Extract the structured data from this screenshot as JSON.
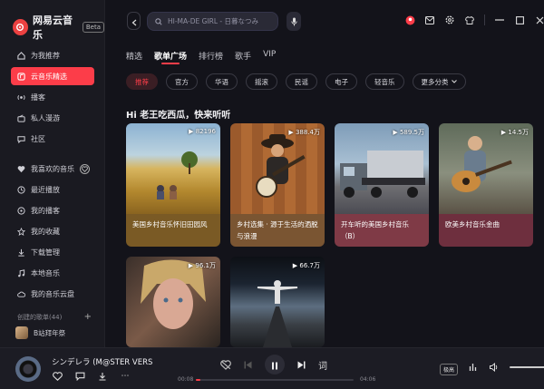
{
  "app": {
    "name": "网易云音乐",
    "beta": "Beta"
  },
  "sidebar": {
    "items": [
      {
        "label": "为我推荐",
        "icon": "home-icon"
      },
      {
        "label": "云音乐精选",
        "icon": "music-note-icon",
        "active": true
      },
      {
        "label": "播客",
        "icon": "podcast-icon"
      },
      {
        "label": "私人漫游",
        "icon": "radio-icon"
      },
      {
        "label": "社区",
        "icon": "community-icon"
      }
    ],
    "my_items": [
      {
        "label": "我喜欢的音乐",
        "icon": "heart-icon"
      },
      {
        "label": "最近播放",
        "icon": "clock-icon"
      },
      {
        "label": "我的播客",
        "icon": "podcast-icon"
      },
      {
        "label": "我的收藏",
        "icon": "star-icon"
      },
      {
        "label": "下载管理",
        "icon": "download-icon"
      },
      {
        "label": "本地音乐",
        "icon": "music-icon"
      },
      {
        "label": "我的音乐云盘",
        "icon": "cloud-icon"
      }
    ],
    "created_playlists": "创建的歌单(44)",
    "playlist_item": "B站拜年祭"
  },
  "search": {
    "placeholder": "HI-MA-DE GIRL - 日暮なつみ"
  },
  "tabs": [
    {
      "label": "精选"
    },
    {
      "label": "歌单广场",
      "active": true
    },
    {
      "label": "排行榜"
    },
    {
      "label": "歌手"
    },
    {
      "label": "VIP"
    }
  ],
  "chips": [
    {
      "label": "推荐",
      "active": true
    },
    {
      "label": "官方"
    },
    {
      "label": "华语"
    },
    {
      "label": "摇滚"
    },
    {
      "label": "民谣"
    },
    {
      "label": "电子"
    },
    {
      "label": "轻音乐"
    },
    {
      "label": "更多分类"
    }
  ],
  "greeting": "Hi 老王吃西瓜，快来听听",
  "cards": [
    {
      "count": "82196",
      "title": "美国乡村音乐怀旧田园风",
      "caption_color": "#7a5a25"
    },
    {
      "count": "388.4万",
      "title": "乡村选集 · 源于生活的洒脱与浪漫",
      "caption_color": "#7a5532"
    },
    {
      "count": "589.5万",
      "title": "开车听的美国乡村音乐（B）",
      "caption_color": "#7f3a46"
    },
    {
      "count": "14.5万",
      "title": "欧美乡村音乐金曲",
      "caption_color": "#6e2f3e"
    },
    {
      "count": "96.1万",
      "title": "",
      "caption_color": "#2b2b33"
    },
    {
      "count": "66.7万",
      "title": "",
      "caption_color": "#2b2b33"
    }
  ],
  "player": {
    "song": "シンデレラ (M@STER VERS",
    "time_current": "00:08",
    "time_total": "04:06",
    "progress": 0.03,
    "lyrics_label": "词",
    "quality": "极高"
  },
  "colors": {
    "accent": "#fc3d49",
    "background": "#13131a",
    "sidebar": "#1a1a21"
  }
}
